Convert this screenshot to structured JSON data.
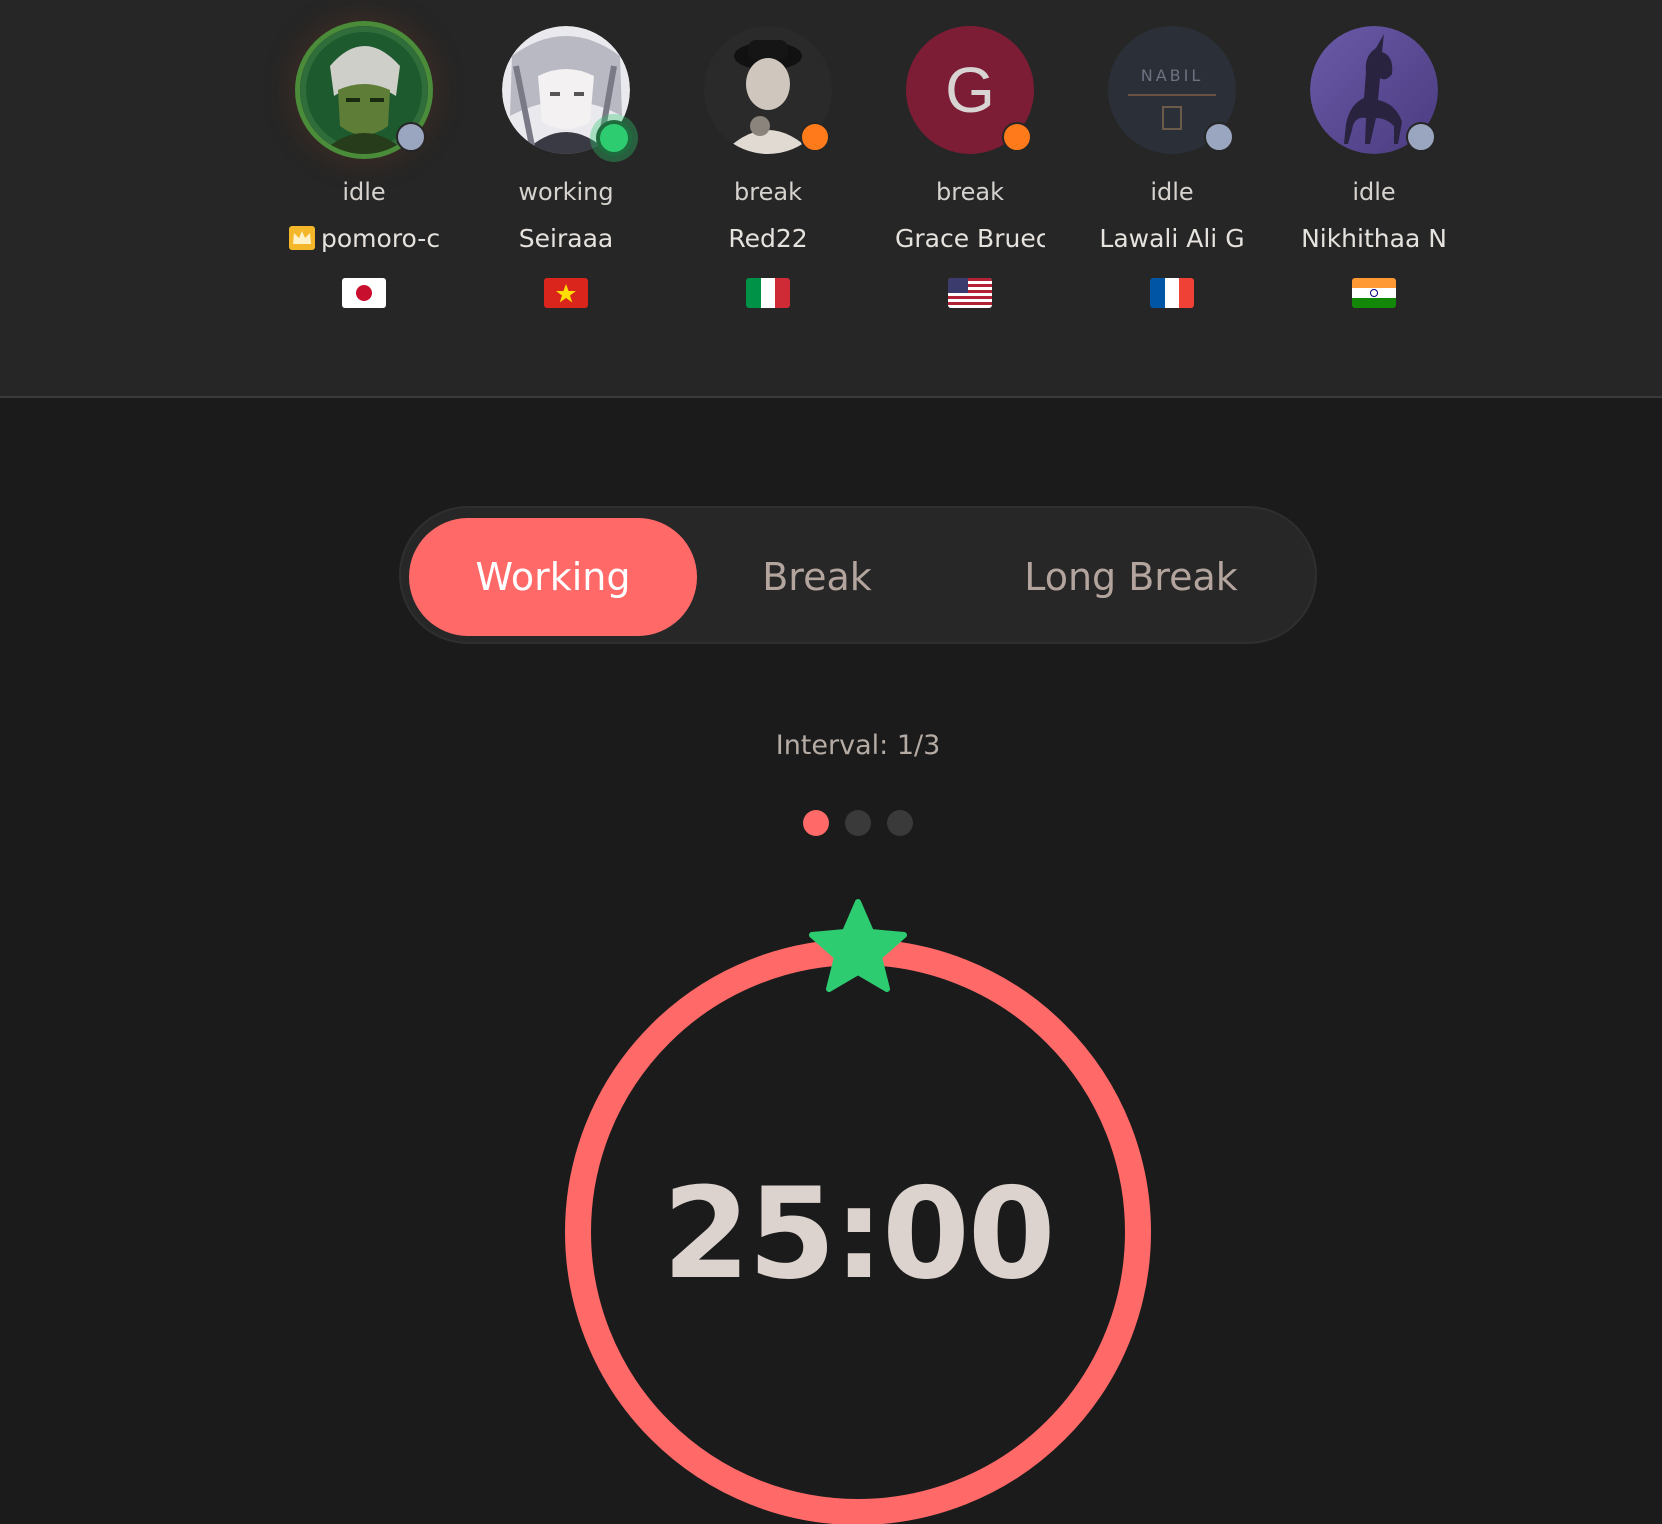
{
  "members": [
    {
      "status": "idle",
      "name": "pomoro-c",
      "is_host": true,
      "flag": "Japan",
      "status_color": "#9aa5bf",
      "avatar": "anime-character-avatar"
    },
    {
      "status": "working",
      "name": "Seiraaa",
      "is_host": false,
      "flag": "Vietnam",
      "status_color": "#2ecc71",
      "avatar": "anime-character-avatar"
    },
    {
      "status": "break",
      "name": "Red22",
      "is_host": false,
      "flag": "Italy",
      "status_color": "#ff7a1a",
      "avatar": "photo-avatar"
    },
    {
      "status": "break",
      "name": "Grace Bruec",
      "is_host": false,
      "flag": "United States",
      "status_color": "#ff7a1a",
      "avatar": "letter-avatar",
      "initial": "G"
    },
    {
      "status": "idle",
      "name": "Lawali Ali G",
      "is_host": false,
      "flag": "France",
      "status_color": "#9aa5bf",
      "avatar": "logo-avatar",
      "avatar_text": "NABIL"
    },
    {
      "status": "idle",
      "name": "Nikhithaa N",
      "is_host": false,
      "flag": "India",
      "status_color": "#9aa5bf",
      "avatar": "unicorn-avatar"
    }
  ],
  "modes": {
    "working": "Working",
    "break": "Break",
    "long_break": "Long Break",
    "active": "working"
  },
  "interval": {
    "label": "Interval: 1/3",
    "current": 1,
    "total": 3
  },
  "timer": {
    "display": "25:00",
    "progress": 0,
    "ring_color": "#ff6a69",
    "marker_color": "#2ecc71"
  },
  "colors": {
    "accent": "#ff6a69",
    "background": "#1b1b1b",
    "panel": "#262626"
  }
}
